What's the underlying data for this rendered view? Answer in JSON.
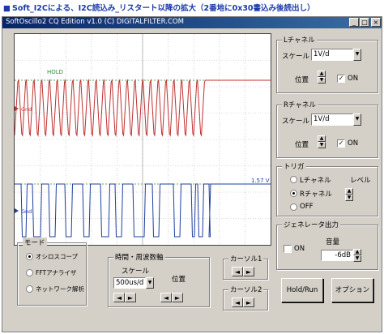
{
  "heading": {
    "bullet": "■",
    "text": "Soft_I2Cによる、I2C読込み_リスタート以降の拡大（2番地に0x30書込み後読出し）"
  },
  "window": {
    "title": "SoftOscillo2 CQ Edition v1.0 (C) DIGITALFILTER.COM",
    "buttons": {
      "minimize": "_",
      "maximize": "□",
      "close": "×"
    }
  },
  "scope": {
    "hold_label": "HOLD",
    "ch1_gnd": "Gnd",
    "ch2_gnd": "Gnd",
    "trigger_level_label": "1.57 V",
    "colors": {
      "ch_left": "#c03030",
      "ch_right": "#1f3f9f",
      "grid": "#a0a0a0",
      "hold": "#2e8b2e"
    }
  },
  "left_channel": {
    "group_label": "Lチャネル",
    "scale_label": "スケール",
    "scale_value": "1V/d",
    "position_label": "位置",
    "on_label": "ON",
    "on_checked": true
  },
  "right_channel": {
    "group_label": "Rチャネル",
    "scale_label": "スケール",
    "scale_value": "1V/d",
    "position_label": "位置",
    "on_label": "ON",
    "on_checked": true
  },
  "trigger": {
    "group_label": "トリガ",
    "options": [
      "Lチャネル",
      "Rチャネル",
      "OFF"
    ],
    "selected_index": 1,
    "level_label": "レベル"
  },
  "generator": {
    "group_label": "ジェネレータ出力",
    "on_label": "ON",
    "volume_label": "音量",
    "volume_value": "-6dB"
  },
  "mode": {
    "group_label": "モード",
    "options": [
      "オシロスコープ",
      "FFTアナライザ",
      "ネットワーク解析"
    ],
    "selected_index": 0
  },
  "time": {
    "group_label": "時間・周波数軸",
    "scale_label": "スケール",
    "scale_value": "500us/d",
    "position_label": "位置"
  },
  "cursor1": {
    "group_label": "カーソル1"
  },
  "cursor2": {
    "group_label": "カーソル2"
  },
  "actions": {
    "hold_run": "Hold/Run",
    "option": "オプション"
  },
  "arrows": {
    "left": "◄",
    "right": "►",
    "up": "▲",
    "down": "▼",
    "check": "✓"
  }
}
